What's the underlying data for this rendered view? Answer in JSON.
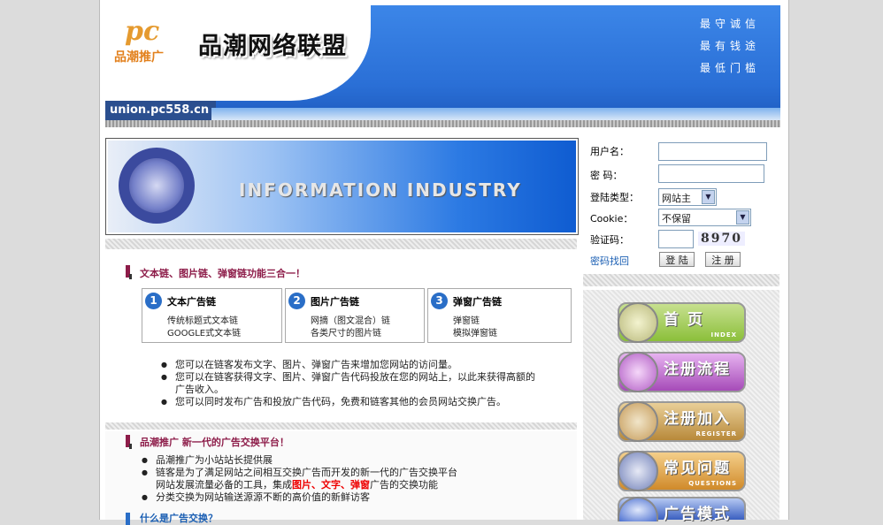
{
  "header": {
    "logo_pc": "pc",
    "logo_sub": "品潮推广",
    "title": "品潮网络联盟",
    "slogans": [
      "最守诚信",
      "最有钱途",
      "最低门槛"
    ],
    "url": "union.pc558.cn"
  },
  "banner": {
    "text": "INFORMATION INDUSTRY"
  },
  "section1": {
    "title": "文本链、图片链、弹窗链功能三合一！",
    "features": [
      {
        "num": "1",
        "title": "文本广告链",
        "lines": [
          "传统标题式文本链",
          "GOOGLE式文本链"
        ]
      },
      {
        "num": "2",
        "title": "图片广告链",
        "lines": [
          "网摘（图文混合）链",
          "各类尺寸的图片链"
        ]
      },
      {
        "num": "3",
        "title": "弹窗广告链",
        "lines": [
          "弹窗链",
          "模拟弹窗链"
        ]
      }
    ],
    "bullets": [
      "您可以在链客发布文字、图片、弹窗广告来增加您网站的访问量。",
      "您可以在链客获得文字、图片、弹窗广告代码投放在您的网站上，以此来获得高额的",
      "广告收入。",
      "您可以同时发布广告和投放广告代码，免费和链客其他的会员网站交换广告。"
    ]
  },
  "section2": {
    "title": "品潮推广  新一代的广告交换平台！",
    "bullets": [
      "品潮推广为小站站长提供展",
      "链客是为了满足网站之间相互交换广告而开发的新一代的广告交换平台",
      "网站发展流量必备的工具，集成",
      "分类交换为网站输送源源不断的高价值的新鲜访客"
    ],
    "highlight": "图片、文字、弹窗",
    "bullet3_tail": "广告的交换功能",
    "next_title": "什么是广告交换？"
  },
  "login": {
    "username_label": "用户名：",
    "username_value": "",
    "password_label": "密  码：",
    "password_value": "",
    "type_label": "登陆类型：",
    "type_value": "网站主",
    "cookie_label": "Cookie：",
    "cookie_value": "不保留",
    "captcha_label": "验证码：",
    "captcha_value": "",
    "captcha_image_text": "8970",
    "forgot": "密码找回",
    "login_btn": "登 陆",
    "register_btn": "注 册"
  },
  "nav": [
    {
      "label": "首  页",
      "sub": "INDEX",
      "color": "#8bbf3a"
    },
    {
      "label": "注册流程",
      "sub": "",
      "color": "#a64bb8"
    },
    {
      "label": "注册加入",
      "sub": "REGISTER",
      "color": "#b8893a"
    },
    {
      "label": "常见问题",
      "sub": "QUESTIONS",
      "color": "#d08a2a"
    },
    {
      "label": "广告模式",
      "sub": "",
      "color": "#3a5fc0"
    }
  ]
}
